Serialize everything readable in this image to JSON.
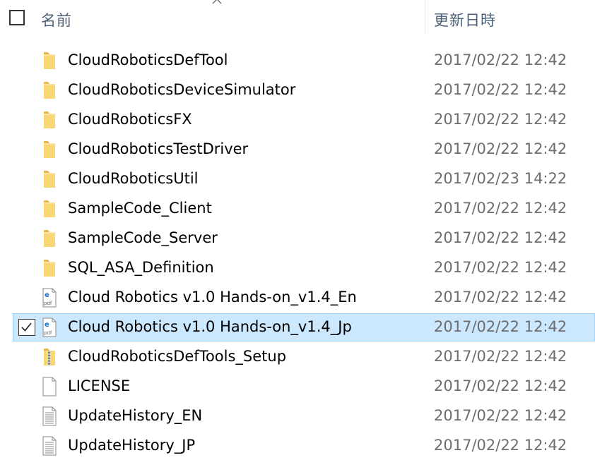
{
  "header": {
    "name_label": "名前",
    "date_label": "更新日時"
  },
  "files": [
    {
      "name": "CloudRoboticsDefTool",
      "date": "2017/02/22 12:42",
      "type": "folder",
      "icon": "folder-icon",
      "selected": false
    },
    {
      "name": "CloudRoboticsDeviceSimulator",
      "date": "2017/02/22 12:42",
      "type": "folder",
      "icon": "folder-icon",
      "selected": false
    },
    {
      "name": "CloudRoboticsFX",
      "date": "2017/02/22 12:42",
      "type": "folder",
      "icon": "folder-icon",
      "selected": false
    },
    {
      "name": "CloudRoboticsTestDriver",
      "date": "2017/02/22 12:42",
      "type": "folder",
      "icon": "folder-icon",
      "selected": false
    },
    {
      "name": "CloudRoboticsUtil",
      "date": "2017/02/23 14:22",
      "type": "folder",
      "icon": "folder-icon",
      "selected": false
    },
    {
      "name": "SampleCode_Client",
      "date": "2017/02/22 12:42",
      "type": "folder",
      "icon": "folder-icon",
      "selected": false
    },
    {
      "name": "SampleCode_Server",
      "date": "2017/02/22 12:42",
      "type": "folder",
      "icon": "folder-icon",
      "selected": false
    },
    {
      "name": "SQL_ASA_Definition",
      "date": "2017/02/22 12:42",
      "type": "folder",
      "icon": "folder-icon",
      "selected": false
    },
    {
      "name": "Cloud Robotics v1.0 Hands-on_v1.4_En",
      "date": "2017/02/22 12:42",
      "type": "pdf",
      "icon": "pdf-file-icon",
      "selected": false
    },
    {
      "name": "Cloud Robotics v1.0 Hands-on_v1.4_Jp",
      "date": "2017/02/22 12:42",
      "type": "pdf",
      "icon": "pdf-file-icon",
      "selected": true
    },
    {
      "name": "CloudRoboticsDefTools_Setup",
      "date": "2017/02/22 12:42",
      "type": "zip",
      "icon": "zip-folder-icon",
      "selected": false
    },
    {
      "name": "LICENSE",
      "date": "2017/02/22 12:42",
      "type": "blank",
      "icon": "blank-file-icon",
      "selected": false
    },
    {
      "name": "UpdateHistory_EN",
      "date": "2017/02/22 12:42",
      "type": "text",
      "icon": "text-file-icon",
      "selected": false
    },
    {
      "name": "UpdateHistory_JP",
      "date": "2017/02/22 12:42",
      "type": "text",
      "icon": "text-file-icon",
      "selected": false
    }
  ],
  "colors": {
    "folder": "#f8d775",
    "folder_dark": "#e8b64c",
    "selection_bg": "#cce8ff",
    "selection_border": "#99d1ff",
    "pdf_blue": "#1e6fc5"
  }
}
